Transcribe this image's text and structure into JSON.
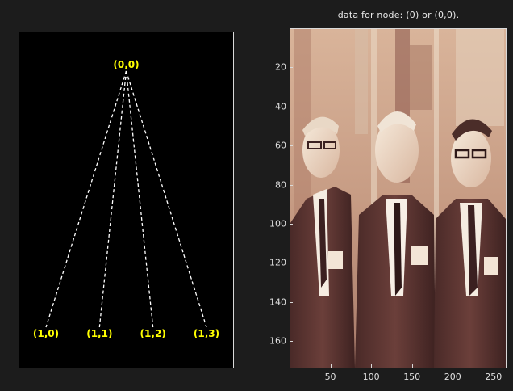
{
  "tree": {
    "root": {
      "label": "(0,0)"
    },
    "children": [
      {
        "label": "(1,0)"
      },
      {
        "label": "(1,1)"
      },
      {
        "label": "(1,2)"
      },
      {
        "label": "(1,3)"
      }
    ],
    "node_color": "#ffff00",
    "edge_color": "#ffffff",
    "background": "#000000"
  },
  "image_panel": {
    "title": "data for node: (0) or (0,0).",
    "y_ticks": [
      "20",
      "40",
      "60",
      "80",
      "100",
      "120",
      "140",
      "160"
    ],
    "x_ticks": [
      "50",
      "100",
      "150",
      "200",
      "250"
    ],
    "colormap": "pink"
  }
}
